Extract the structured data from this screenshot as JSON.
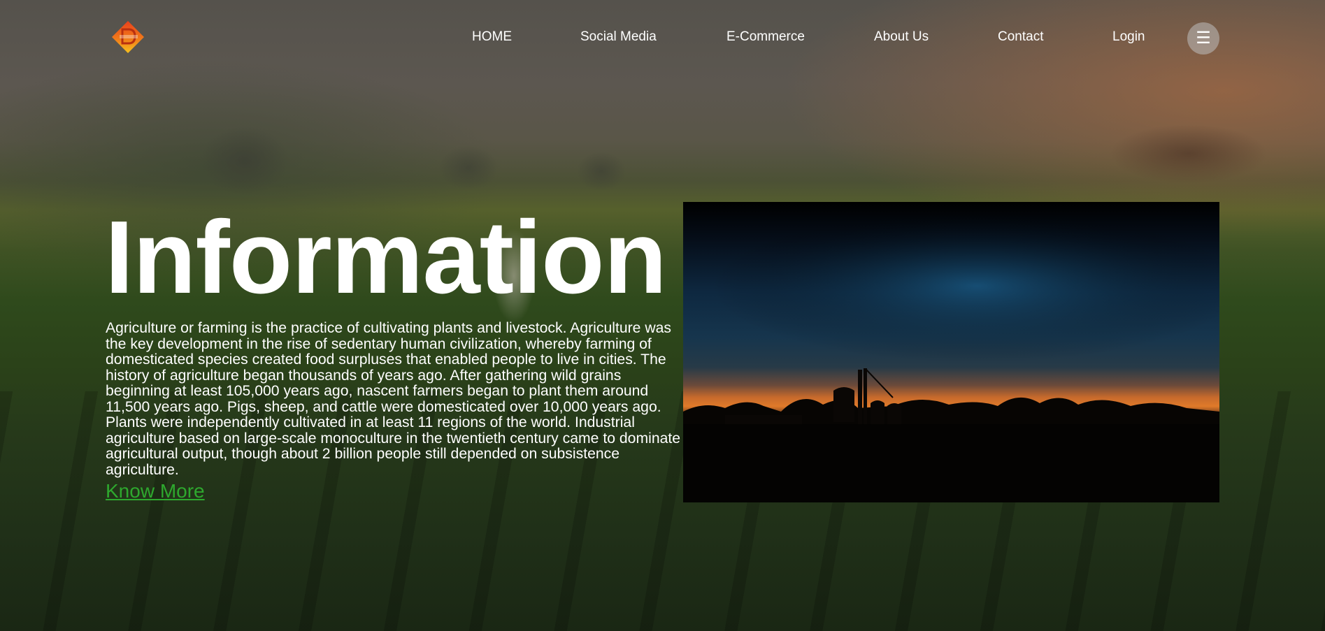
{
  "header": {
    "logo_alt": "DigiAgro",
    "nav": [
      {
        "label": "HOME"
      },
      {
        "label": "Social Media"
      },
      {
        "label": "E-Commerce"
      },
      {
        "label": "About Us"
      },
      {
        "label": "Contact"
      },
      {
        "label": "Login"
      }
    ],
    "menu_icon": "☰"
  },
  "main": {
    "title": "Information",
    "description": "Agriculture or farming is the practice of cultivating plants and livestock. Agriculture was the key development in the rise of sedentary human civilization, whereby farming of domesticated species created food surpluses that enabled people to live in cities. The history of agriculture began thousands of years ago. After gathering wild grains beginning at least 105,000 years ago, nascent farmers began to plant them around 11,500 years ago. Pigs, sheep, and cattle were domesticated over 10,000 years ago. Plants were independently cultivated in at least 11 regions of the world. Industrial agriculture based on large-scale monoculture in the twentieth century came to dominate agricultural output, though about 2 billion people still depended on subsistence agriculture.",
    "know_more": "Know More"
  },
  "colors": {
    "link_green": "#2ea82e",
    "logo_orange": "#f07a1a",
    "logo_red": "#e8401c",
    "logo_yellow": "#f7c21e"
  }
}
